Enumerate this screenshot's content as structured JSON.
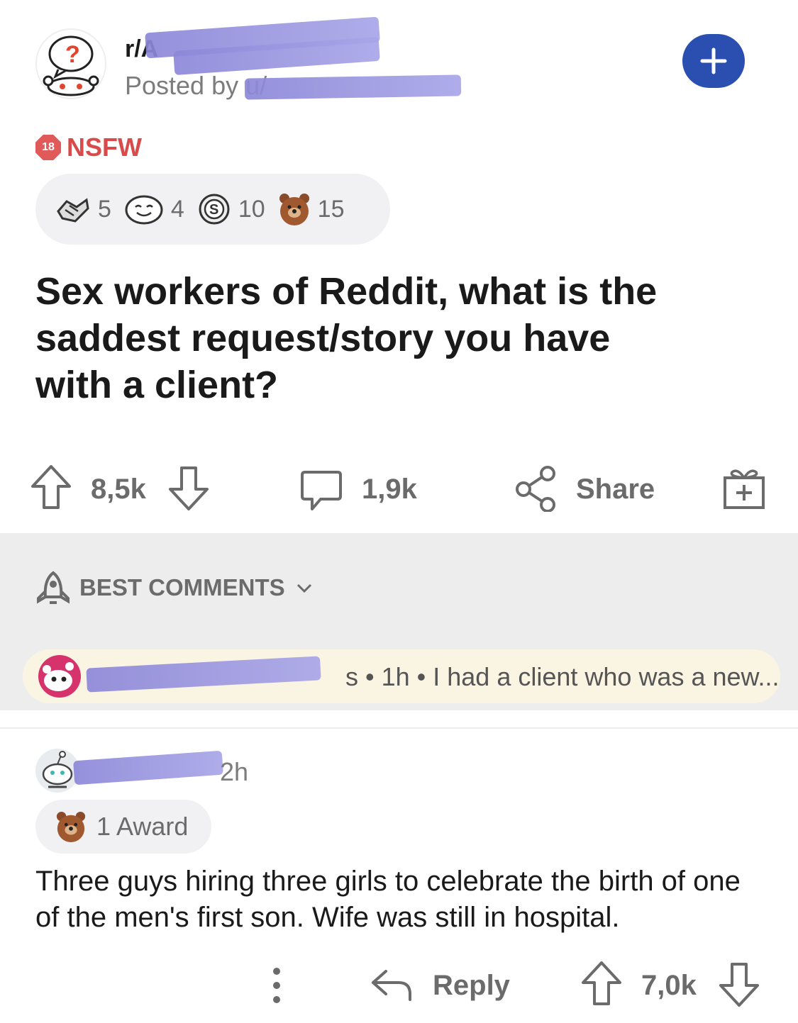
{
  "header": {
    "subreddit": "r/A",
    "posted_by": "Posted by u/",
    "join_icon": "plus-icon"
  },
  "nsfw": {
    "badge": "18",
    "label": "NSFW"
  },
  "awards": [
    {
      "icon": "handshake-award-icon",
      "count": "5"
    },
    {
      "icon": "smile-award-icon",
      "count": "4"
    },
    {
      "icon": "s-coin-award-icon",
      "count": "10"
    },
    {
      "icon": "bear-award-icon",
      "count": "15"
    }
  ],
  "post": {
    "title": "Sex workers of Reddit, what is the saddest request/story you have with a client?",
    "upvotes": "8,5k",
    "comments": "1,9k",
    "share": "Share"
  },
  "sort": {
    "label": "BEST COMMENTS"
  },
  "preview": {
    "text": "s • 1h • I had a client who was a new..."
  },
  "comment": {
    "time": "2h",
    "award_label": "1 Award",
    "body": "Three guys hiring three girls to celebrate the birth of one of the men's first son. Wife was still in hospital.",
    "reply": "Reply",
    "votes": "7,0k"
  },
  "colors": {
    "accent_blue": "#2a4fb0",
    "nsfw_red": "#d94a4a",
    "redaction": "#8c87d8",
    "preview_bg": "#faf4e3"
  }
}
